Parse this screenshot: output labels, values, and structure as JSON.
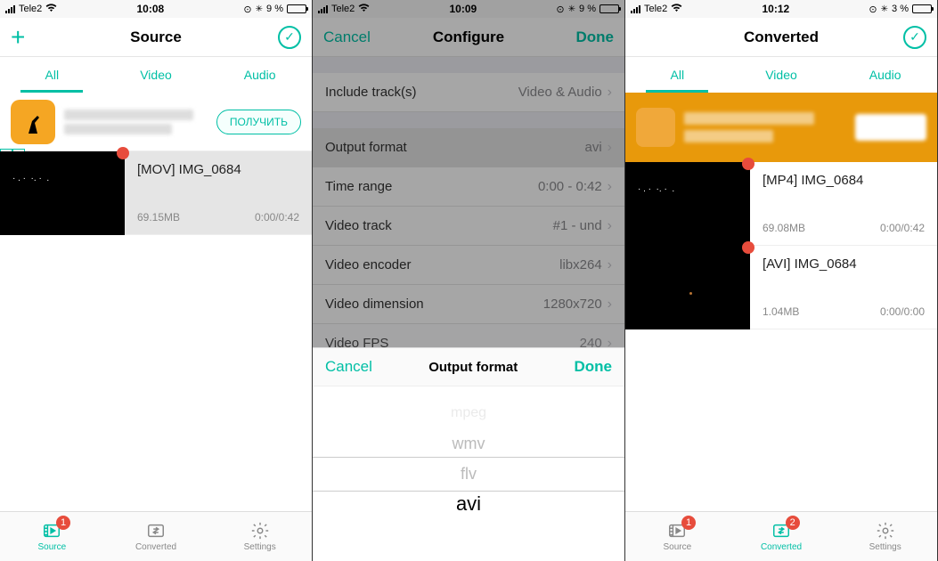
{
  "screen1": {
    "status": {
      "carrier": "Tele2",
      "time": "10:08",
      "battery_pct": "9 %"
    },
    "nav_title": "Source",
    "tabs": {
      "all": "All",
      "video": "Video",
      "audio": "Audio"
    },
    "ad": {
      "cta": "ПОЛУЧИТЬ"
    },
    "file": {
      "name": "[MOV] IMG_0684",
      "size": "69.15MB",
      "time": "0:00/0:42"
    },
    "tabbar": {
      "source": "Source",
      "converted": "Converted",
      "settings": "Settings",
      "badge_source": "1"
    }
  },
  "screen2": {
    "status": {
      "carrier": "Tele2",
      "time": "10:09",
      "battery_pct": "9 %"
    },
    "nav": {
      "cancel": "Cancel",
      "title": "Configure",
      "done": "Done"
    },
    "rows": {
      "include_tracks": {
        "label": "Include track(s)",
        "value": "Video & Audio"
      },
      "output_format": {
        "label": "Output format",
        "value": "avi"
      },
      "time_range": {
        "label": "Time range",
        "value": "0:00 - 0:42"
      },
      "video_track": {
        "label": "Video track",
        "value": "#1 - und"
      },
      "video_encoder": {
        "label": "Video encoder",
        "value": "libx264"
      },
      "video_dimension": {
        "label": "Video dimension",
        "value": "1280x720"
      },
      "video_fps": {
        "label": "Video FPS",
        "value": "240"
      }
    },
    "picker": {
      "cancel": "Cancel",
      "title": "Output format",
      "done": "Done",
      "opts": {
        "o1": "mpeg",
        "o2": "wmv",
        "o3": "flv",
        "sel": "avi"
      }
    }
  },
  "screen3": {
    "status": {
      "carrier": "Tele2",
      "time": "10:12",
      "battery_pct": "3 %"
    },
    "nav_title": "Converted",
    "tabs": {
      "all": "All",
      "video": "Video",
      "audio": "Audio"
    },
    "file1": {
      "name": "[MP4] IMG_0684",
      "size": "69.08MB",
      "time": "0:00/0:42"
    },
    "file2": {
      "name": "[AVI] IMG_0684",
      "size": "1.04MB",
      "time": "0:00/0:00"
    },
    "tabbar": {
      "source": "Source",
      "converted": "Converted",
      "settings": "Settings",
      "badge_source": "1",
      "badge_conv": "2"
    }
  },
  "icons": {
    "checkmark": "✓",
    "chevron": "›",
    "bluetooth": "✻",
    "lock": "⊙"
  }
}
